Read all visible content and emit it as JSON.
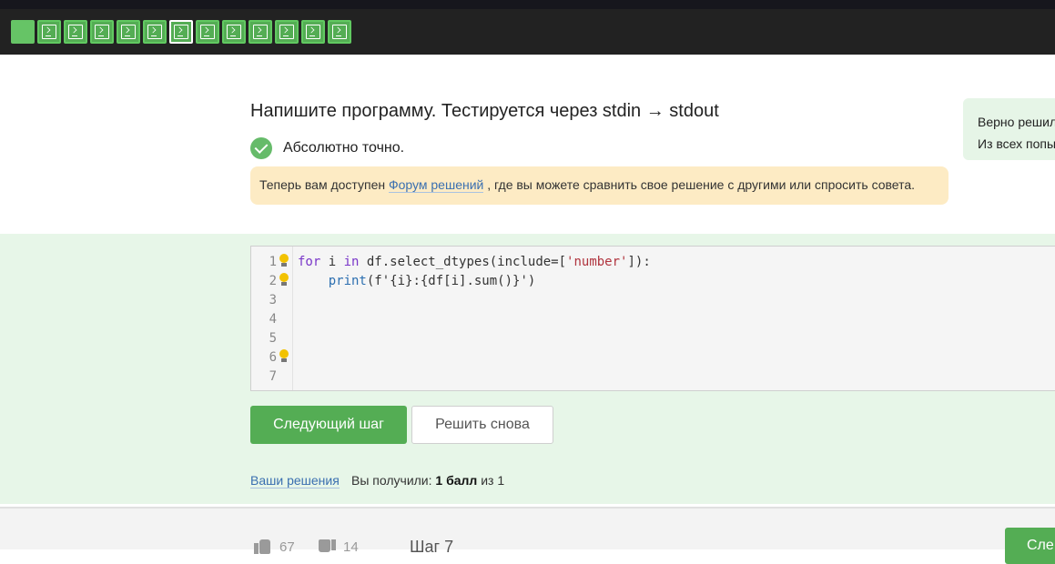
{
  "task": {
    "title": "Напишите программу. Тестируется через stdin → stdout",
    "result": "Абсолютно точно.",
    "notice_before": "Теперь вам доступен ",
    "notice_link": "Форум решений",
    "notice_after": ", где вы можете сравнить свое решение с другими или спросить совета."
  },
  "side_card": {
    "line1": "Верно решил",
    "line2": "Из всех попы"
  },
  "editor": {
    "line_numbers": [
      "1",
      "2",
      "3",
      "4",
      "5",
      "6",
      "7"
    ],
    "line1": {
      "kw1": "for",
      "v1": " i ",
      "kw2": "in",
      "v2": " df.select_dtypes(include=[",
      "str": "'number'",
      "v3": "]):"
    },
    "line2": {
      "indent": "    ",
      "fn": "print",
      "v1": "(f'{i}:{df[i].sum()}')"
    }
  },
  "buttons": {
    "next_step": "Следующий шаг",
    "retry": "Решить снова",
    "next_bottom": "Сле"
  },
  "footer": {
    "solutions_link": "Ваши решения",
    "score_prefix": "Вы получили: ",
    "score_value": "1 балл",
    "score_suffix": " из 1",
    "likes": "67",
    "dislikes": "14",
    "step_label": "Шаг 7"
  },
  "colors": {
    "accent_green": "#54ad54",
    "notice_bg": "#fdebc4",
    "code_area_bg": "#e7f6e8"
  }
}
